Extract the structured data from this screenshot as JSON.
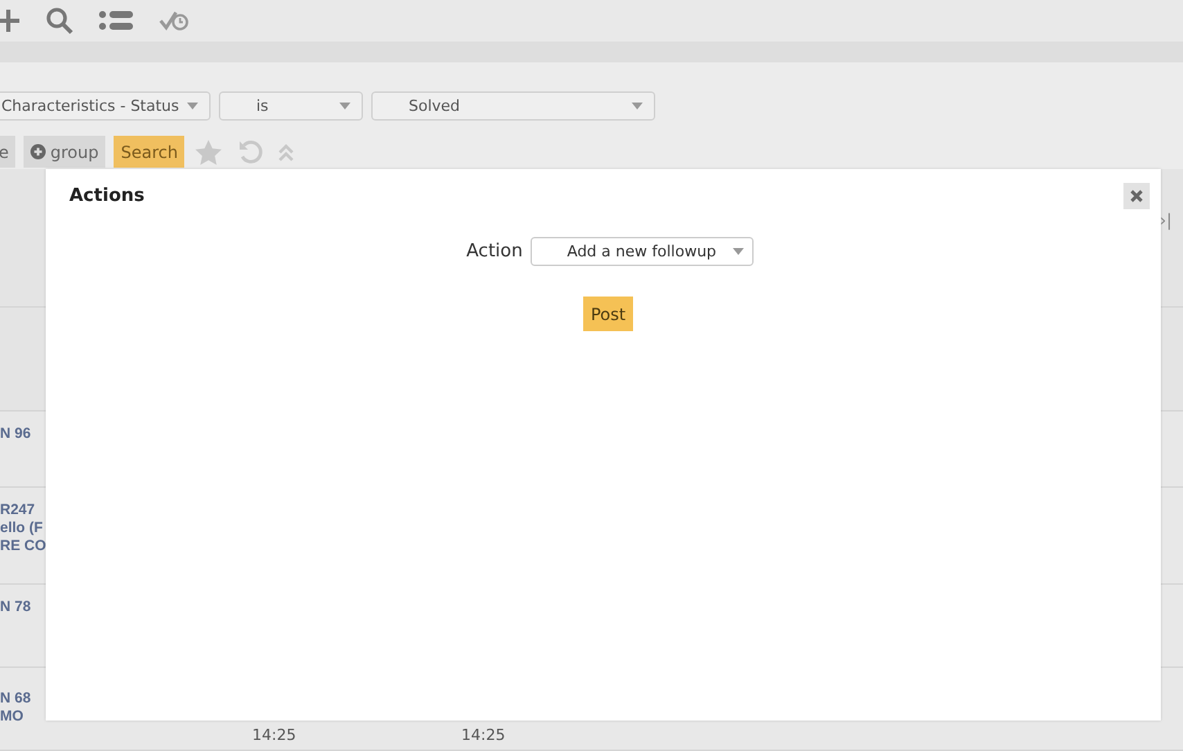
{
  "filter": {
    "field": "Characteristics - Status",
    "operator": "is",
    "value": "Solved"
  },
  "filter_buttons": [
    {
      "label": "e",
      "kind": "plain"
    },
    {
      "label": "group",
      "kind": "add"
    },
    {
      "label": "Search",
      "kind": "primary"
    }
  ],
  "pager": "›|",
  "rows": [
    {
      "lines": [
        "N 96"
      ],
      "times": []
    },
    {
      "lines": [
        "R247",
        "ello (F",
        "RE CO"
      ],
      "times": []
    },
    {
      "lines": [
        "N 78"
      ],
      "times": []
    },
    {
      "lines": [
        "N 68",
        "MO"
      ],
      "times": [
        "14:25",
        "14:25"
      ]
    }
  ],
  "modal": {
    "title": "Actions",
    "action_label": "Action",
    "action_value": "Add a new followup",
    "submit": "Post"
  }
}
